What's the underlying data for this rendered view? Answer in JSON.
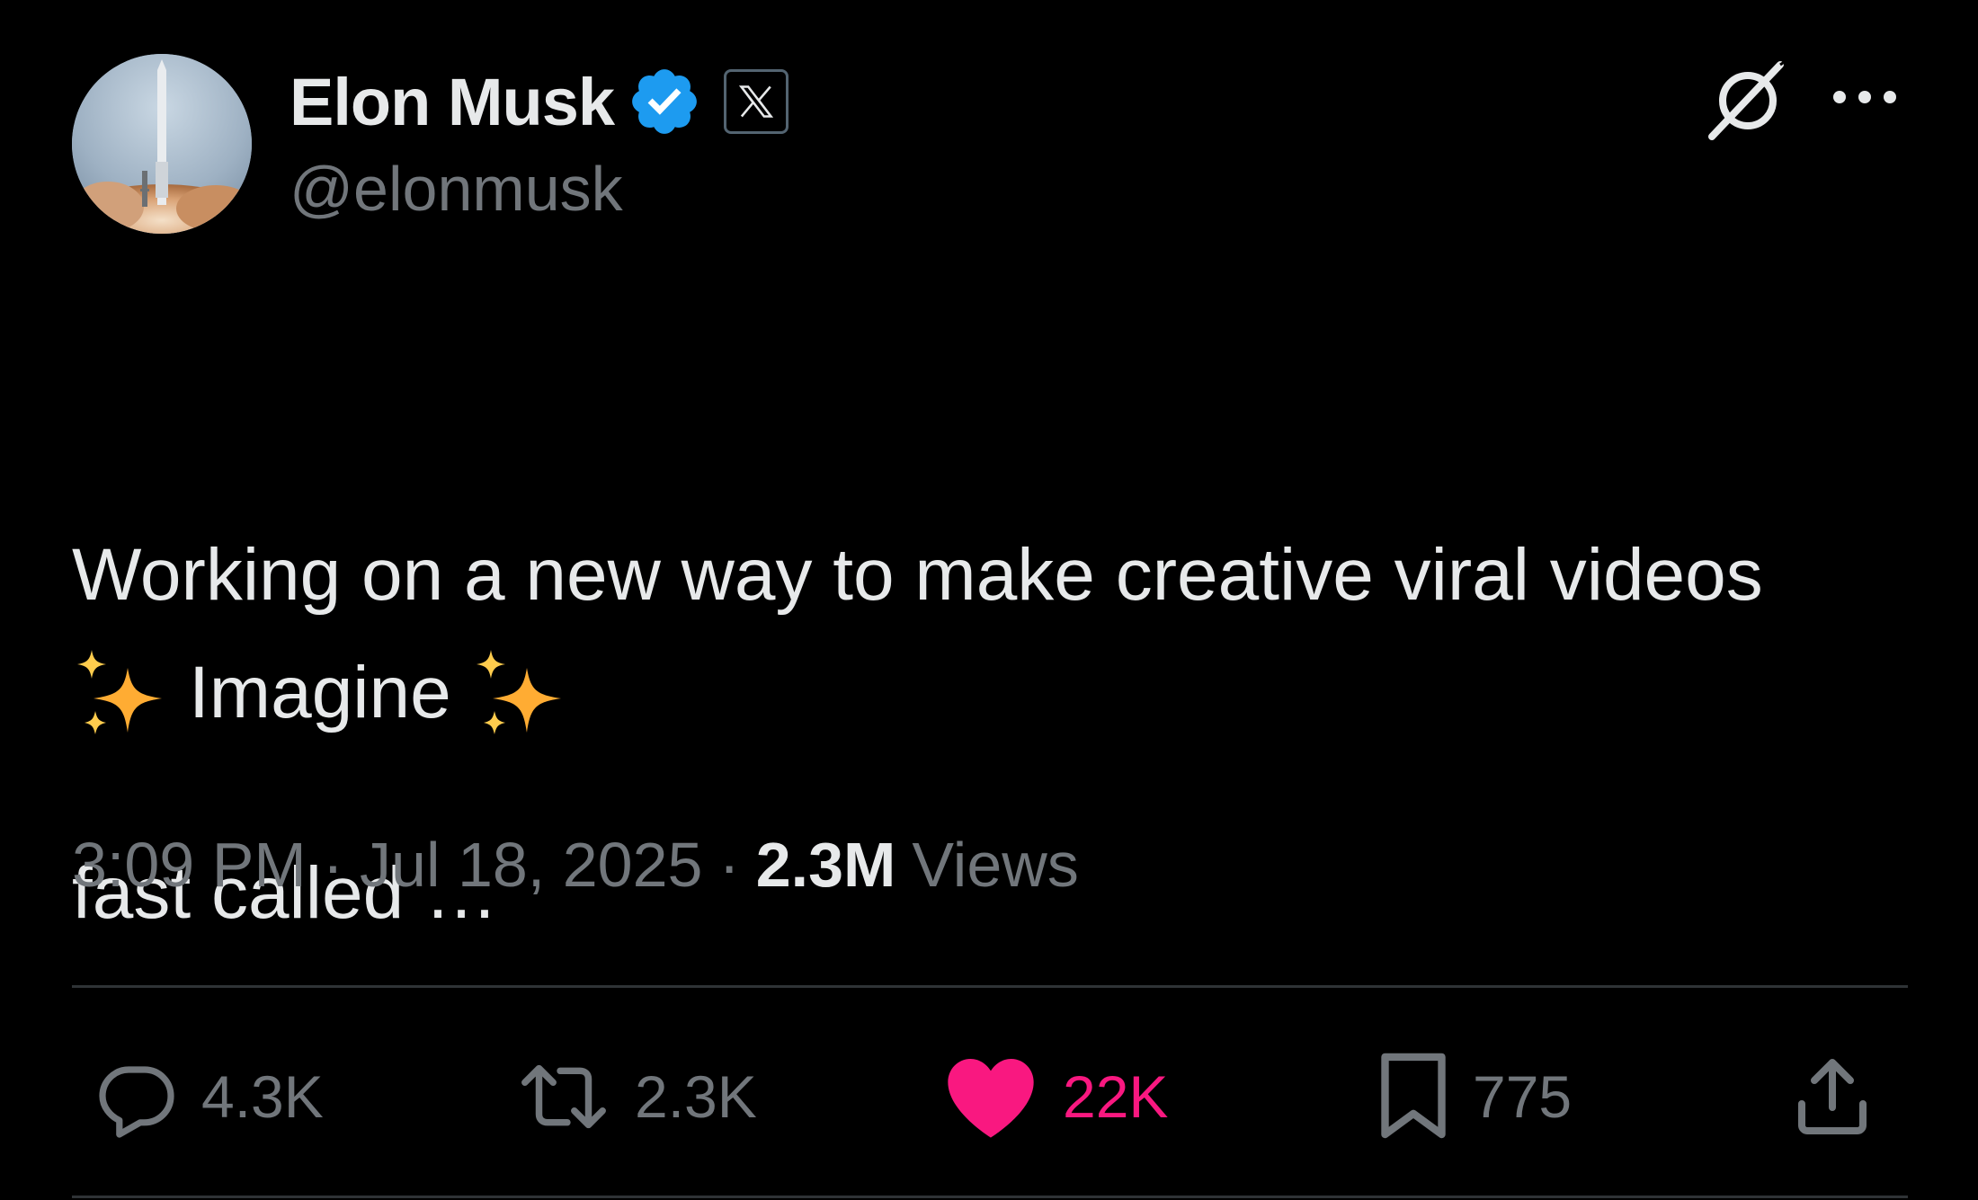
{
  "author": {
    "display_name": "Elon Musk",
    "handle": "@elonmusk",
    "verified": true,
    "affiliate_badge": "x-logo-icon"
  },
  "tweet": {
    "text_lines": [
      "Working on a new way to make creative viral videos",
      "fast called …"
    ],
    "highlight_word": "Imagine",
    "emoji": "sparkles-icon"
  },
  "meta": {
    "time": "3:09 PM",
    "separator": "·",
    "date": "Jul 18, 2025",
    "views_count": "2.3M",
    "views_label": "Views"
  },
  "actions": {
    "reply_count": "4.3K",
    "repost_count": "2.3K",
    "like_count": "22K",
    "bookmark_count": "775"
  },
  "colors": {
    "background": "#000000",
    "text_primary": "#e7e9ea",
    "text_secondary": "#71767b",
    "verified_blue": "#1d9bf0",
    "like_pink": "#f91880",
    "divider": "#2f3336",
    "sparkle": "#ffac33"
  },
  "icons": {
    "top_right": [
      "grok-icon",
      "more-icon"
    ],
    "actions": [
      "reply-icon",
      "repost-icon",
      "like-icon",
      "bookmark-icon",
      "share-icon"
    ]
  }
}
